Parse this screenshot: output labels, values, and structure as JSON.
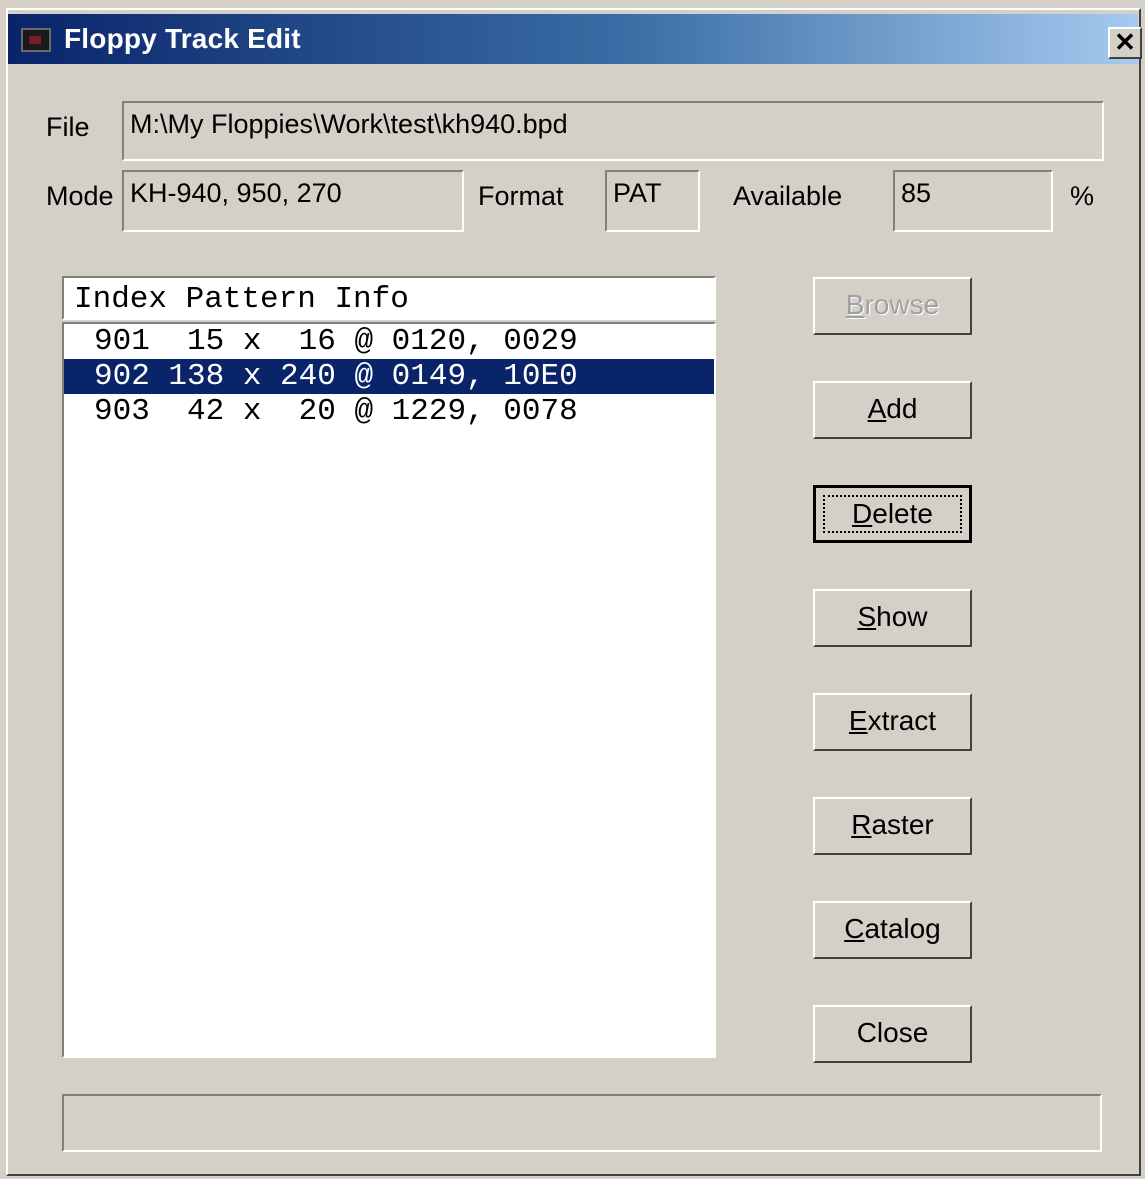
{
  "window": {
    "title": "Floppy Track Edit",
    "close_glyph": "✕",
    "title_gradient": [
      "#0a246a",
      "#a6caf0"
    ]
  },
  "fields": {
    "file_label": "File",
    "file_value": "M:\\My Floppies\\Work\\test\\kh940.bpd",
    "mode_label": "Mode",
    "mode_value": "KH-940, 950, 270",
    "format_label": "Format",
    "format_value": "PAT",
    "available_label": "Available",
    "available_value": "85",
    "available_unit": "%"
  },
  "list": {
    "header": "Index Pattern Info",
    "selected_color": "#0a246a",
    "rows": [
      {
        "text": "901  15 x  16 @ 0120, 0029",
        "selected": false
      },
      {
        "text": "902 138 x 240 @ 0149, 10E0",
        "selected": true
      },
      {
        "text": "903  42 x  20 @ 1229, 0078",
        "selected": false
      }
    ]
  },
  "buttons": {
    "browse": {
      "mnemonic": "B",
      "rest": "rowse",
      "enabled": false
    },
    "add": {
      "mnemonic": "A",
      "rest": "dd"
    },
    "delete": {
      "mnemonic": "D",
      "rest": "elete",
      "focused": true
    },
    "show": {
      "mnemonic": "S",
      "rest": "how"
    },
    "extract": {
      "mnemonic": "E",
      "rest": "xtract"
    },
    "raster": {
      "mnemonic": "R",
      "rest": "aster"
    },
    "catalog": {
      "mnemonic": "C",
      "rest": "atalog"
    },
    "close": {
      "label": "Close"
    }
  },
  "status_bar": {
    "text": ""
  }
}
